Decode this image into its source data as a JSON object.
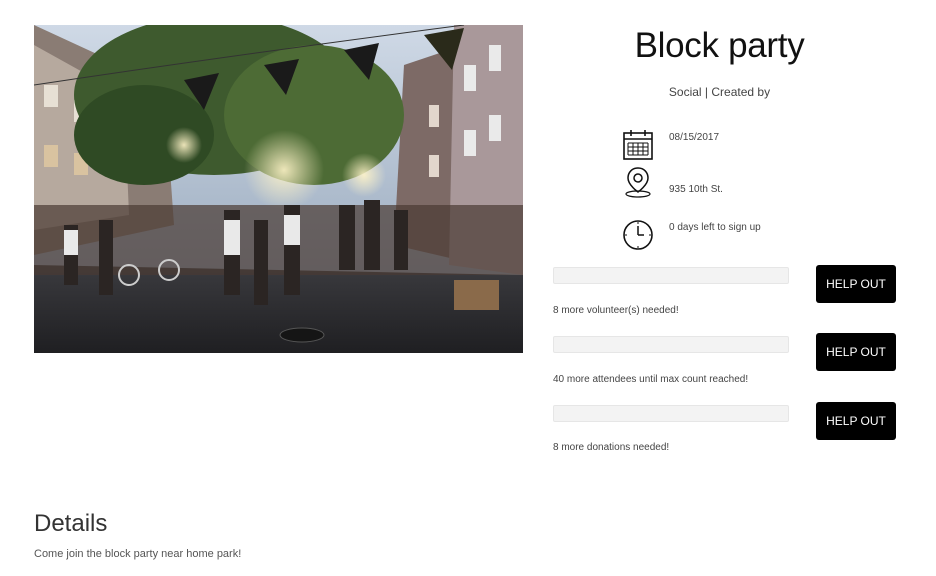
{
  "event": {
    "title": "Block party",
    "subtitle": "Social | Created by",
    "image_alt": "block-party-street-photo"
  },
  "info": {
    "date": "08/15/2017",
    "location": "935 10th St.",
    "time_left": "0 days left to sign up",
    "icons": [
      "calendar-icon",
      "location-pin-icon",
      "clock-icon"
    ]
  },
  "progress": [
    {
      "fill_fraction": 0.0,
      "need_text": "8 more volunteer(s) needed!",
      "button_label": "HELP OUT"
    },
    {
      "fill_fraction": 0.0,
      "need_text": "40 more attendees until max count reached!",
      "button_label": "HELP OUT"
    },
    {
      "fill_fraction": 0.0,
      "need_text": "8 more donations needed!",
      "button_label": "HELP OUT"
    }
  ],
  "details": {
    "heading": "Details",
    "description": "Come join the block party near home park!"
  },
  "colors": {
    "button_bg": "#000000",
    "button_text": "#ffffff",
    "bar_bg": "#f3f3f3"
  }
}
